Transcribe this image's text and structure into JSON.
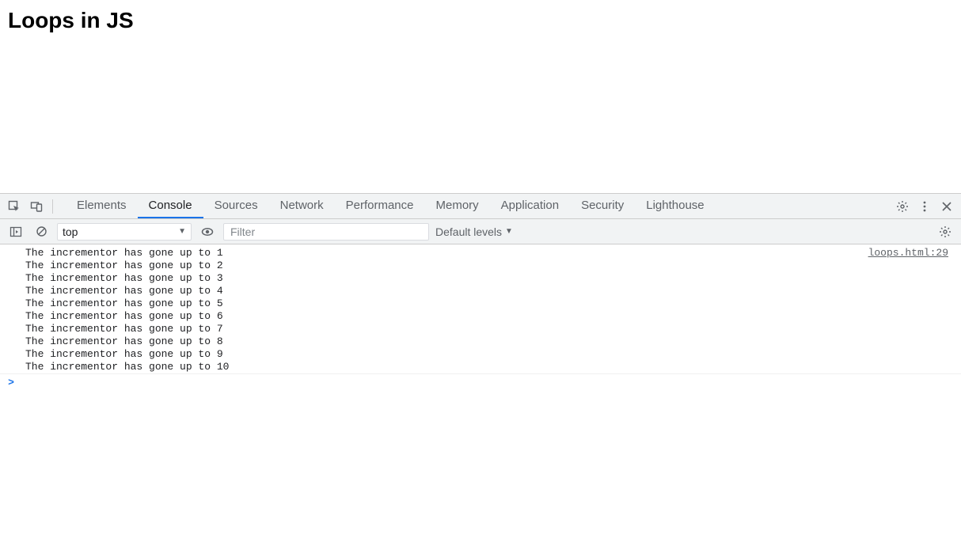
{
  "page": {
    "heading": "Loops in JS"
  },
  "devtools": {
    "tabs": [
      "Elements",
      "Console",
      "Sources",
      "Network",
      "Performance",
      "Memory",
      "Application",
      "Security",
      "Lighthouse"
    ],
    "active_tab": "Console"
  },
  "console_toolbar": {
    "context": "top",
    "filter_placeholder": "Filter",
    "levels_label": "Default levels"
  },
  "console_log": {
    "source": "loops.html:29",
    "lines": [
      "The incrementor has gone up to 1",
      "The incrementor has gone up to 2",
      "The incrementor has gone up to 3",
      "The incrementor has gone up to 4",
      "The incrementor has gone up to 5",
      "The incrementor has gone up to 6",
      "The incrementor has gone up to 7",
      "The incrementor has gone up to 8",
      "The incrementor has gone up to 9",
      "The incrementor has gone up to 10"
    ]
  },
  "prompt": {
    "glyph": ">"
  }
}
